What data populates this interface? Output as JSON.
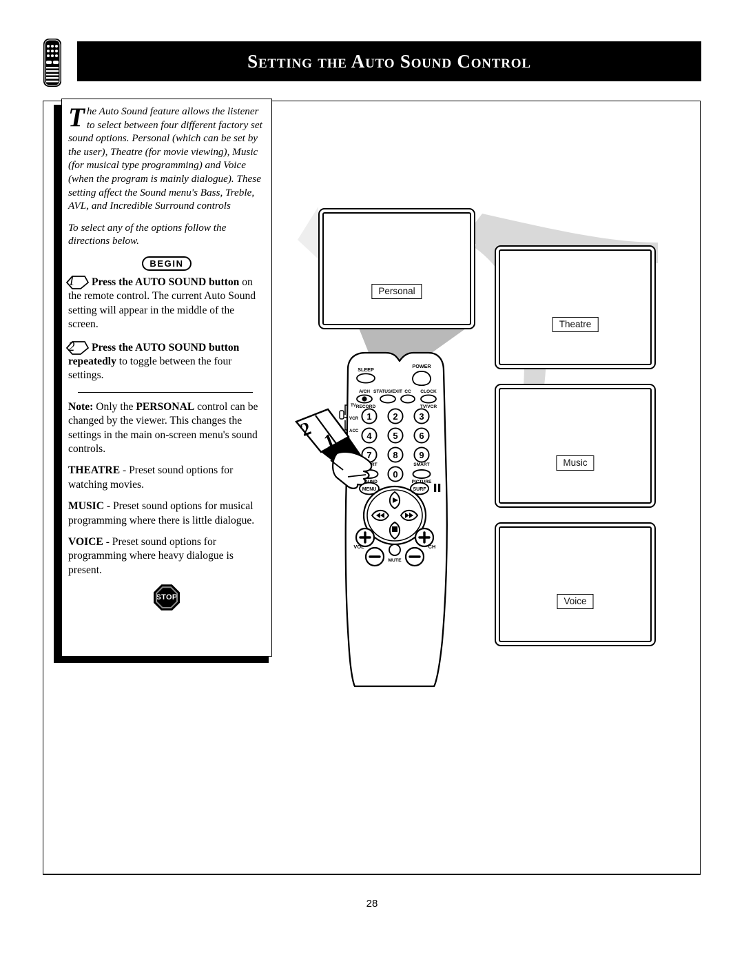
{
  "page": {
    "number": "28",
    "title": "Setting the Auto Sound Control",
    "header_icon": "remote-control-icon"
  },
  "intro": {
    "dropcap": "T",
    "paragraph": "he Auto Sound feature allows the listener to select between four different factory set sound options. Personal (which can be set by the user), Theatre (for movie viewing), Music (for musical type programming) and Voice (when the program is mainly dialogue). These setting affect the Sound menu's Bass, Treble, AVL, and Incredible Surround controls",
    "follow_up": "To select any of the options follow the directions below."
  },
  "begin_badge": "BEGIN",
  "stop_badge": "STOP",
  "steps": [
    {
      "number": "1",
      "bold_lead": "Press the AUTO  SOUND button",
      "rest": " on the remote control. The current Auto Sound setting will appear in the middle of the screen."
    },
    {
      "number": "2",
      "bold_lead": "Press the AUTO  SOUND button",
      "bold_cont": "repeatedly",
      "rest": " to toggle between the four settings."
    }
  ],
  "notes": [
    {
      "lead": "Note:",
      "bold_mid": "PERSONAL",
      "pre": " Only the ",
      "rest": " control can be changed by the viewer. This changes the settings in the main on-screen menu's sound controls."
    },
    {
      "lead": "THEATRE",
      "rest": " - Preset sound options for watching movies."
    },
    {
      "lead": "MUSIC",
      "rest": " - Preset sound options for musical programming where there is little dialogue."
    },
    {
      "lead": "VOICE",
      "rest": " - Preset sound options for programming where heavy dialogue is present."
    }
  ],
  "tv_screens": [
    {
      "label": "Personal"
    },
    {
      "label": "Theatre"
    },
    {
      "label": "Music"
    },
    {
      "label": "Voice"
    }
  ],
  "remote": {
    "callout_numbers": [
      "2",
      "1"
    ],
    "top_buttons": [
      {
        "label": "SLEEP"
      },
      {
        "label": "POWER"
      }
    ],
    "row_buttons": [
      {
        "label": "A/CH"
      },
      {
        "label": "STATUS/EXIT"
      },
      {
        "label": "CC"
      },
      {
        "label": "CLOCK"
      }
    ],
    "sub_labels": [
      {
        "label": "RECORD"
      },
      {
        "label": "TV/VCR"
      }
    ],
    "slider_positions": [
      "TV",
      "VCR",
      "ACC"
    ],
    "keypad": [
      "1",
      "2",
      "3",
      "4",
      "5",
      "6",
      "7",
      "8",
      "9",
      "0"
    ],
    "smart_buttons": [
      {
        "top": "SMART",
        "bottom": "SOUND"
      },
      {
        "top": "SMART",
        "bottom": "PICTURE"
      }
    ],
    "nav_buttons": [
      {
        "label": "MENU"
      },
      {
        "label": "SURF"
      }
    ],
    "pad_icons": [
      "play-icon",
      "rewind-icon",
      "fast-forward-icon",
      "stop-icon"
    ],
    "pause_icon": "pause-icon",
    "vol_label": "VOL",
    "ch_label": "CH",
    "mute_label": "MUTE",
    "plus_label": "+",
    "minus_label": "−"
  },
  "colors": {
    "ink": "#000000",
    "paper": "#ffffff",
    "swoosh_gray": "#d9d9d9"
  }
}
